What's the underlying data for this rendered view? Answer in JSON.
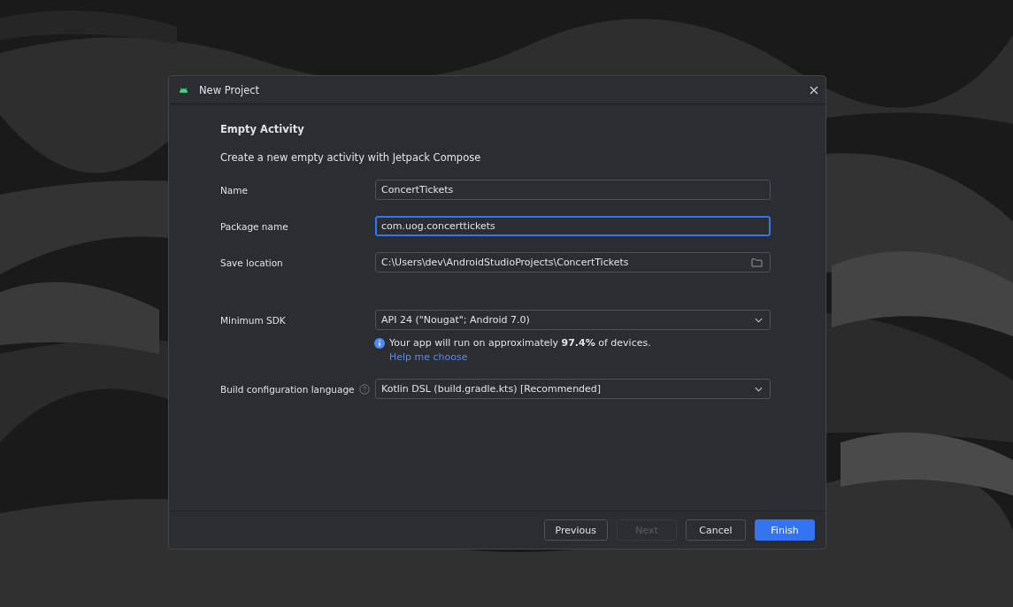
{
  "window": {
    "title": "New Project"
  },
  "heading": "Empty Activity",
  "description": "Create a new empty activity with Jetpack Compose",
  "fields": [
    {
      "label": "Name",
      "kind": "text",
      "value": "ConcertTickets",
      "focused": false
    },
    {
      "label": "Package name",
      "kind": "text",
      "value": "com.uog.concerttickets",
      "focused": true
    },
    {
      "label": "Save location",
      "kind": "path",
      "value": "C:\\Users\\dev\\AndroidStudioProjects\\ConcertTickets",
      "focused": false
    },
    {
      "label": "Minimum SDK",
      "kind": "dropdown",
      "value": "API 24 (\"Nougat\"; Android 7.0)",
      "focused": false,
      "info": "Your app will run on approximately **97.4%** of devices.",
      "link": "Help me choose"
    },
    {
      "label": "Build configuration language",
      "kind": "dropdown",
      "value": "Kotlin DSL (build.gradle.kts) [Recommended]",
      "focused": false,
      "help": true
    }
  ],
  "buttons": [
    {
      "label": "Previous",
      "kind": "default",
      "disabled": false
    },
    {
      "label": "Next",
      "kind": "default",
      "disabled": true
    },
    {
      "label": "Cancel",
      "kind": "default",
      "disabled": false
    },
    {
      "label": "Finish",
      "kind": "primary",
      "disabled": false
    }
  ]
}
